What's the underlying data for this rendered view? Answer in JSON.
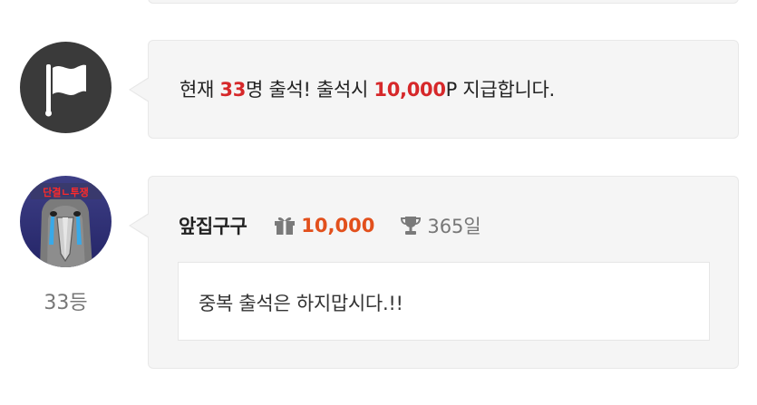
{
  "notice": {
    "prefix": "현재 ",
    "count": "33",
    "middle": "명 출석! 출석시 ",
    "points": "10,000",
    "suffix": "P 지급합니다."
  },
  "comment": {
    "author": "앞집구구",
    "points": "10,000",
    "days": "365일",
    "rank": "33등",
    "message": "중복 출석은 하지맙시다.!!",
    "avatar_caption": "단결ㄴ투쟁"
  },
  "icons": {
    "notice": "flag-icon",
    "points": "gift-icon",
    "days": "trophy-icon"
  },
  "colors": {
    "highlight": "#d6282a",
    "points": "#e2501c",
    "muted": "#777777",
    "card_bg": "#f5f5f5"
  }
}
